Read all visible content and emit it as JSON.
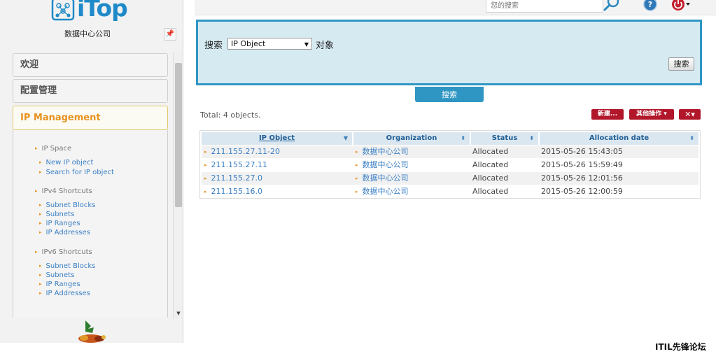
{
  "app": {
    "logo_text": "iTop",
    "organization": "数据中心公司"
  },
  "sidebar": {
    "accordions": [
      {
        "label": "欢迎"
      },
      {
        "label": "配置管理"
      },
      {
        "label": "IP Management"
      }
    ],
    "menu": [
      {
        "label": "IP Space",
        "kind": "group"
      },
      {
        "label": "New IP object",
        "kind": "link"
      },
      {
        "label": "Search for IP object",
        "kind": "link"
      },
      {
        "label": "IPv4 Shortcuts",
        "kind": "group"
      },
      {
        "label": "Subnet Blocks",
        "kind": "link"
      },
      {
        "label": "Subnets",
        "kind": "link"
      },
      {
        "label": "IP Ranges",
        "kind": "link"
      },
      {
        "label": "IP Addresses",
        "kind": "link"
      },
      {
        "label": "IPv6 Shortcuts",
        "kind": "group"
      },
      {
        "label": "Subnet Blocks",
        "kind": "link"
      },
      {
        "label": "Subnets",
        "kind": "link"
      },
      {
        "label": "IP Ranges",
        "kind": "link"
      },
      {
        "label": "IP Addresses",
        "kind": "link"
      }
    ]
  },
  "topbar": {
    "search_placeholder": "您的搜索"
  },
  "search_form": {
    "label": "搜索",
    "class_value": "IP Object",
    "object_label": "对象",
    "submit_label": "搜索",
    "tab_label": "搜索"
  },
  "results": {
    "total": "Total: 4 objects.",
    "actions": {
      "new": "新建...",
      "other": "其他操作 ▾",
      "tools": "✕▾"
    },
    "columns": [
      "IP Object",
      "Organization",
      "Status",
      "Allocation date"
    ],
    "rows": [
      [
        "211.155.27.11-20",
        "数据中心公司",
        "Allocated",
        "2015-05-26 15:43:05"
      ],
      [
        "211.155.27.11",
        "数据中心公司",
        "Allocated",
        "2015-05-26 15:59:49"
      ],
      [
        "211.155.27.0",
        "数据中心公司",
        "Allocated",
        "2015-05-26 12:01:56"
      ],
      [
        "211.155.16.0",
        "数据中心公司",
        "Allocated",
        "2015-05-26 12:00:59"
      ]
    ]
  },
  "watermark": "ITIL先锋论坛",
  "colors": {
    "accent": "#2f96c4",
    "action": "#b1162a",
    "menu_active": "#e8921e",
    "link": "#3a7fc4"
  }
}
